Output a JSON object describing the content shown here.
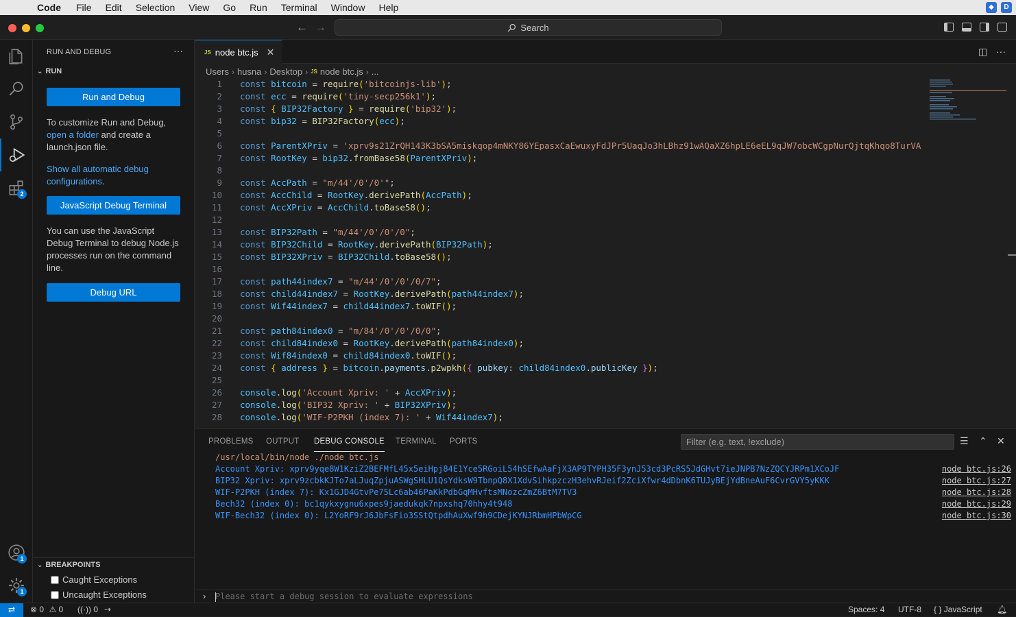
{
  "menubar": {
    "app": "Code",
    "items": [
      "File",
      "Edit",
      "Selection",
      "View",
      "Go",
      "Run",
      "Terminal",
      "Window",
      "Help"
    ]
  },
  "titlebar": {
    "search_placeholder": "Search"
  },
  "activity": {
    "debug_badge": "2",
    "accounts_badge": "1",
    "settings_badge": "1"
  },
  "sidebar": {
    "title": "RUN AND DEBUG",
    "run_section": "RUN",
    "run_and_debug_button": "Run and Debug",
    "customize_text_1": "To customize Run and Debug,",
    "customize_link": "open a folder",
    "customize_text_2": " and create a launch.json file.",
    "show_debug_link": "Show all automatic debug configurations",
    "show_debug_period": ".",
    "js_terminal_button": "JavaScript Debug Terminal",
    "js_terminal_text": "You can use the JavaScript Debug Terminal to debug Node.js processes run on the command line.",
    "debug_url_button": "Debug URL",
    "breakpoints_section": "BREAKPOINTS",
    "breakpoints": [
      "Caught Exceptions",
      "Uncaught Exceptions"
    ]
  },
  "editor": {
    "tab_label": "node btc.js",
    "tab_badge": "JS",
    "breadcrumb": [
      "Users",
      "husna",
      "Desktop",
      "node btc.js",
      "..."
    ],
    "line_numbers": [
      "1",
      "2",
      "3",
      "4",
      "5",
      "6",
      "7",
      "8",
      "9",
      "10",
      "11",
      "12",
      "13",
      "14",
      "15",
      "16",
      "17",
      "18",
      "19",
      "20",
      "21",
      "22",
      "23",
      "24",
      "25",
      "26",
      "27",
      "28"
    ],
    "code": {
      "l1_name": "bitcoin",
      "l1_mod": "'bitcoinjs-lib'",
      "l2_name": "ecc",
      "l2_mod": "'tiny-secp256k1'",
      "l3_name": "BIP32Factory",
      "l3_mod": "'bip32'",
      "l4_name": "bip32",
      "l6_name": "ParentXPriv",
      "l6_val": "'xprv9s21ZrQH143K3bSA5miskqop4mNKY86YEpasxCaEwuxyFdJPr5UaqJo3hLBhz91wAQaXZ6hpLE6eEL9qJW7obcWCgpNurQjtqKhqo8TurVA'",
      "l7_name": "RootKey",
      "l7_arg": "ParentXPriv",
      "l9_name": "AccPath",
      "l9_val": "\"m/44'/0'/0'\"",
      "l10_name": "AccChild",
      "l10_arg": "AccPath",
      "l11_name": "AccXPriv",
      "l11_obj": "AccChild",
      "l13_name": "BIP32Path",
      "l13_val": "\"m/44'/0'/0'/0\"",
      "l14_name": "BIP32Child",
      "l14_arg": "BIP32Path",
      "l15_name": "BIP32XPriv",
      "l15_obj": "BIP32Child",
      "l17_name": "path44index7",
      "l17_val": "\"m/44'/0'/0'/0/7\"",
      "l18_name": "child44index7",
      "l18_arg": "path44index7",
      "l19_name": "Wif44index7",
      "l19_obj": "child44index7",
      "l21_name": "path84index0",
      "l21_val": "\"m/84'/0'/0'/0/0\"",
      "l22_name": "child84index0",
      "l22_arg": "path84index0",
      "l23_name": "Wif84index0",
      "l23_obj": "child84index0",
      "l24_name": "address",
      "l24_arg": "child84index0",
      "l26_str": "'Account Xpriv: '",
      "l26_arg": "AccXPriv",
      "l27_str": "'BIP32 Xpriv: '",
      "l27_arg": "BIP32XPriv",
      "l28_str": "'WIF-P2PKH (index 7): '",
      "l28_arg": "Wif44index7"
    }
  },
  "panel": {
    "tabs": [
      "PROBLEMS",
      "OUTPUT",
      "DEBUG CONSOLE",
      "TERMINAL",
      "PORTS"
    ],
    "filter_placeholder": "Filter (e.g. text, !exclude)",
    "output": [
      {
        "text": "/usr/local/bin/node ./node btc.js",
        "source": ""
      },
      {
        "text": "Account Xpriv: xprv9yqe8W1KziZ2BEFMfL45x5eiHpj84E1Yce5RGoiL54hSEfwAaFjX3AP9TYPH35F3ynJ53cd3PcRS5JdGHvt7ieJNPB7NzZQCYJRPm1XCoJF",
        "source": "node btc.js:26"
      },
      {
        "text": "BIP32 Xpriv: xprv9zcbkKJTo7aLJuqZpjuASWgSHLU1QsYdksW9TbnpQ8X1XdvSihkpzczH3ehvRJeif2ZciXfwr4dDbnK6TUJyBEjYdBneAuF6CvrGVY5yKKK",
        "source": "node btc.js:27"
      },
      {
        "text": "WIF-P2PKH (index 7): Kx1GJD4GtvPe75Lc6ab46PaKkPdbGqMHvftsMNozcZmZ6BtM7TV3",
        "source": "node btc.js:28"
      },
      {
        "text": "Bech32 (index 0): bc1qykxygnu6xpes9jaedukqk7npxshq70hhy4t948",
        "source": "node btc.js:29"
      },
      {
        "text": "WIF-Bech32 (index 0): L2YoRF9rJ6JbFsFio3SStQtpdhAuXwf9h9CDejKYNJRbmHPbWpCG",
        "source": "node btc.js:30"
      }
    ],
    "input_placeholder": "Please start a debug session to evaluate expressions"
  },
  "statusbar": {
    "errors": "0",
    "warnings": "0",
    "ports": "0",
    "spaces": "Spaces: 4",
    "encoding": "UTF-8",
    "language": "JavaScript"
  },
  "colors": {
    "accent": "#0078d4",
    "link": "#4daafc",
    "console_blue": "#3794ff"
  }
}
